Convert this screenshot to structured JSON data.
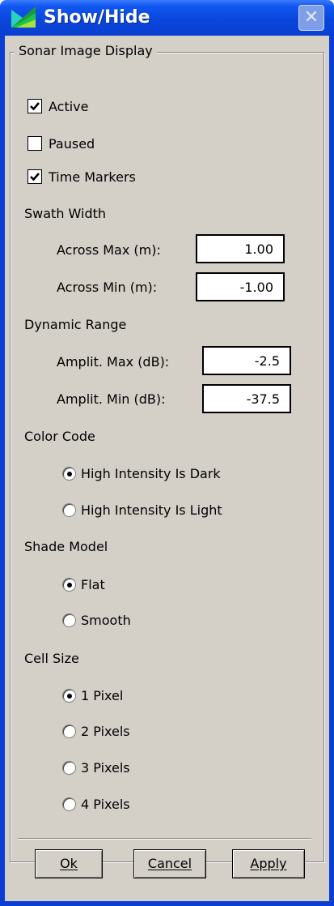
{
  "window": {
    "title": "Show/Hide",
    "close_icon": "close-icon"
  },
  "group": {
    "title": "Sonar Image Display"
  },
  "checkboxes": {
    "active": {
      "label": "Active",
      "checked": true
    },
    "paused": {
      "label": "Paused",
      "checked": false
    },
    "time_markers": {
      "label": "Time Markers",
      "checked": true
    }
  },
  "swath_width": {
    "heading": "Swath Width",
    "across_max_label": "Across Max (m):",
    "across_max_value": "1.00",
    "across_min_label": "Across Min (m):",
    "across_min_value": "-1.00"
  },
  "dynamic_range": {
    "heading": "Dynamic Range",
    "amplit_max_label": "Amplit. Max (dB):",
    "amplit_max_value": "-2.5",
    "amplit_min_label": "Amplit. Min (dB):",
    "amplit_min_value": "-37.5"
  },
  "color_code": {
    "heading": "Color Code",
    "options": [
      "High Intensity Is Dark",
      "High Intensity Is Light"
    ],
    "selected": "High Intensity Is Dark"
  },
  "shade_model": {
    "heading": "Shade Model",
    "options": [
      "Flat",
      "Smooth"
    ],
    "selected": "Flat"
  },
  "cell_size": {
    "heading": "Cell Size",
    "options": [
      "1 Pixel",
      "2 Pixels",
      "3 Pixels",
      "4 Pixels"
    ],
    "selected": "1 Pixel"
  },
  "buttons": {
    "ok": "Ok",
    "cancel": "Cancel",
    "apply": "Apply"
  },
  "colors": {
    "titlebar": "#0a46dc",
    "dialog_face": "#d4d0c8"
  }
}
